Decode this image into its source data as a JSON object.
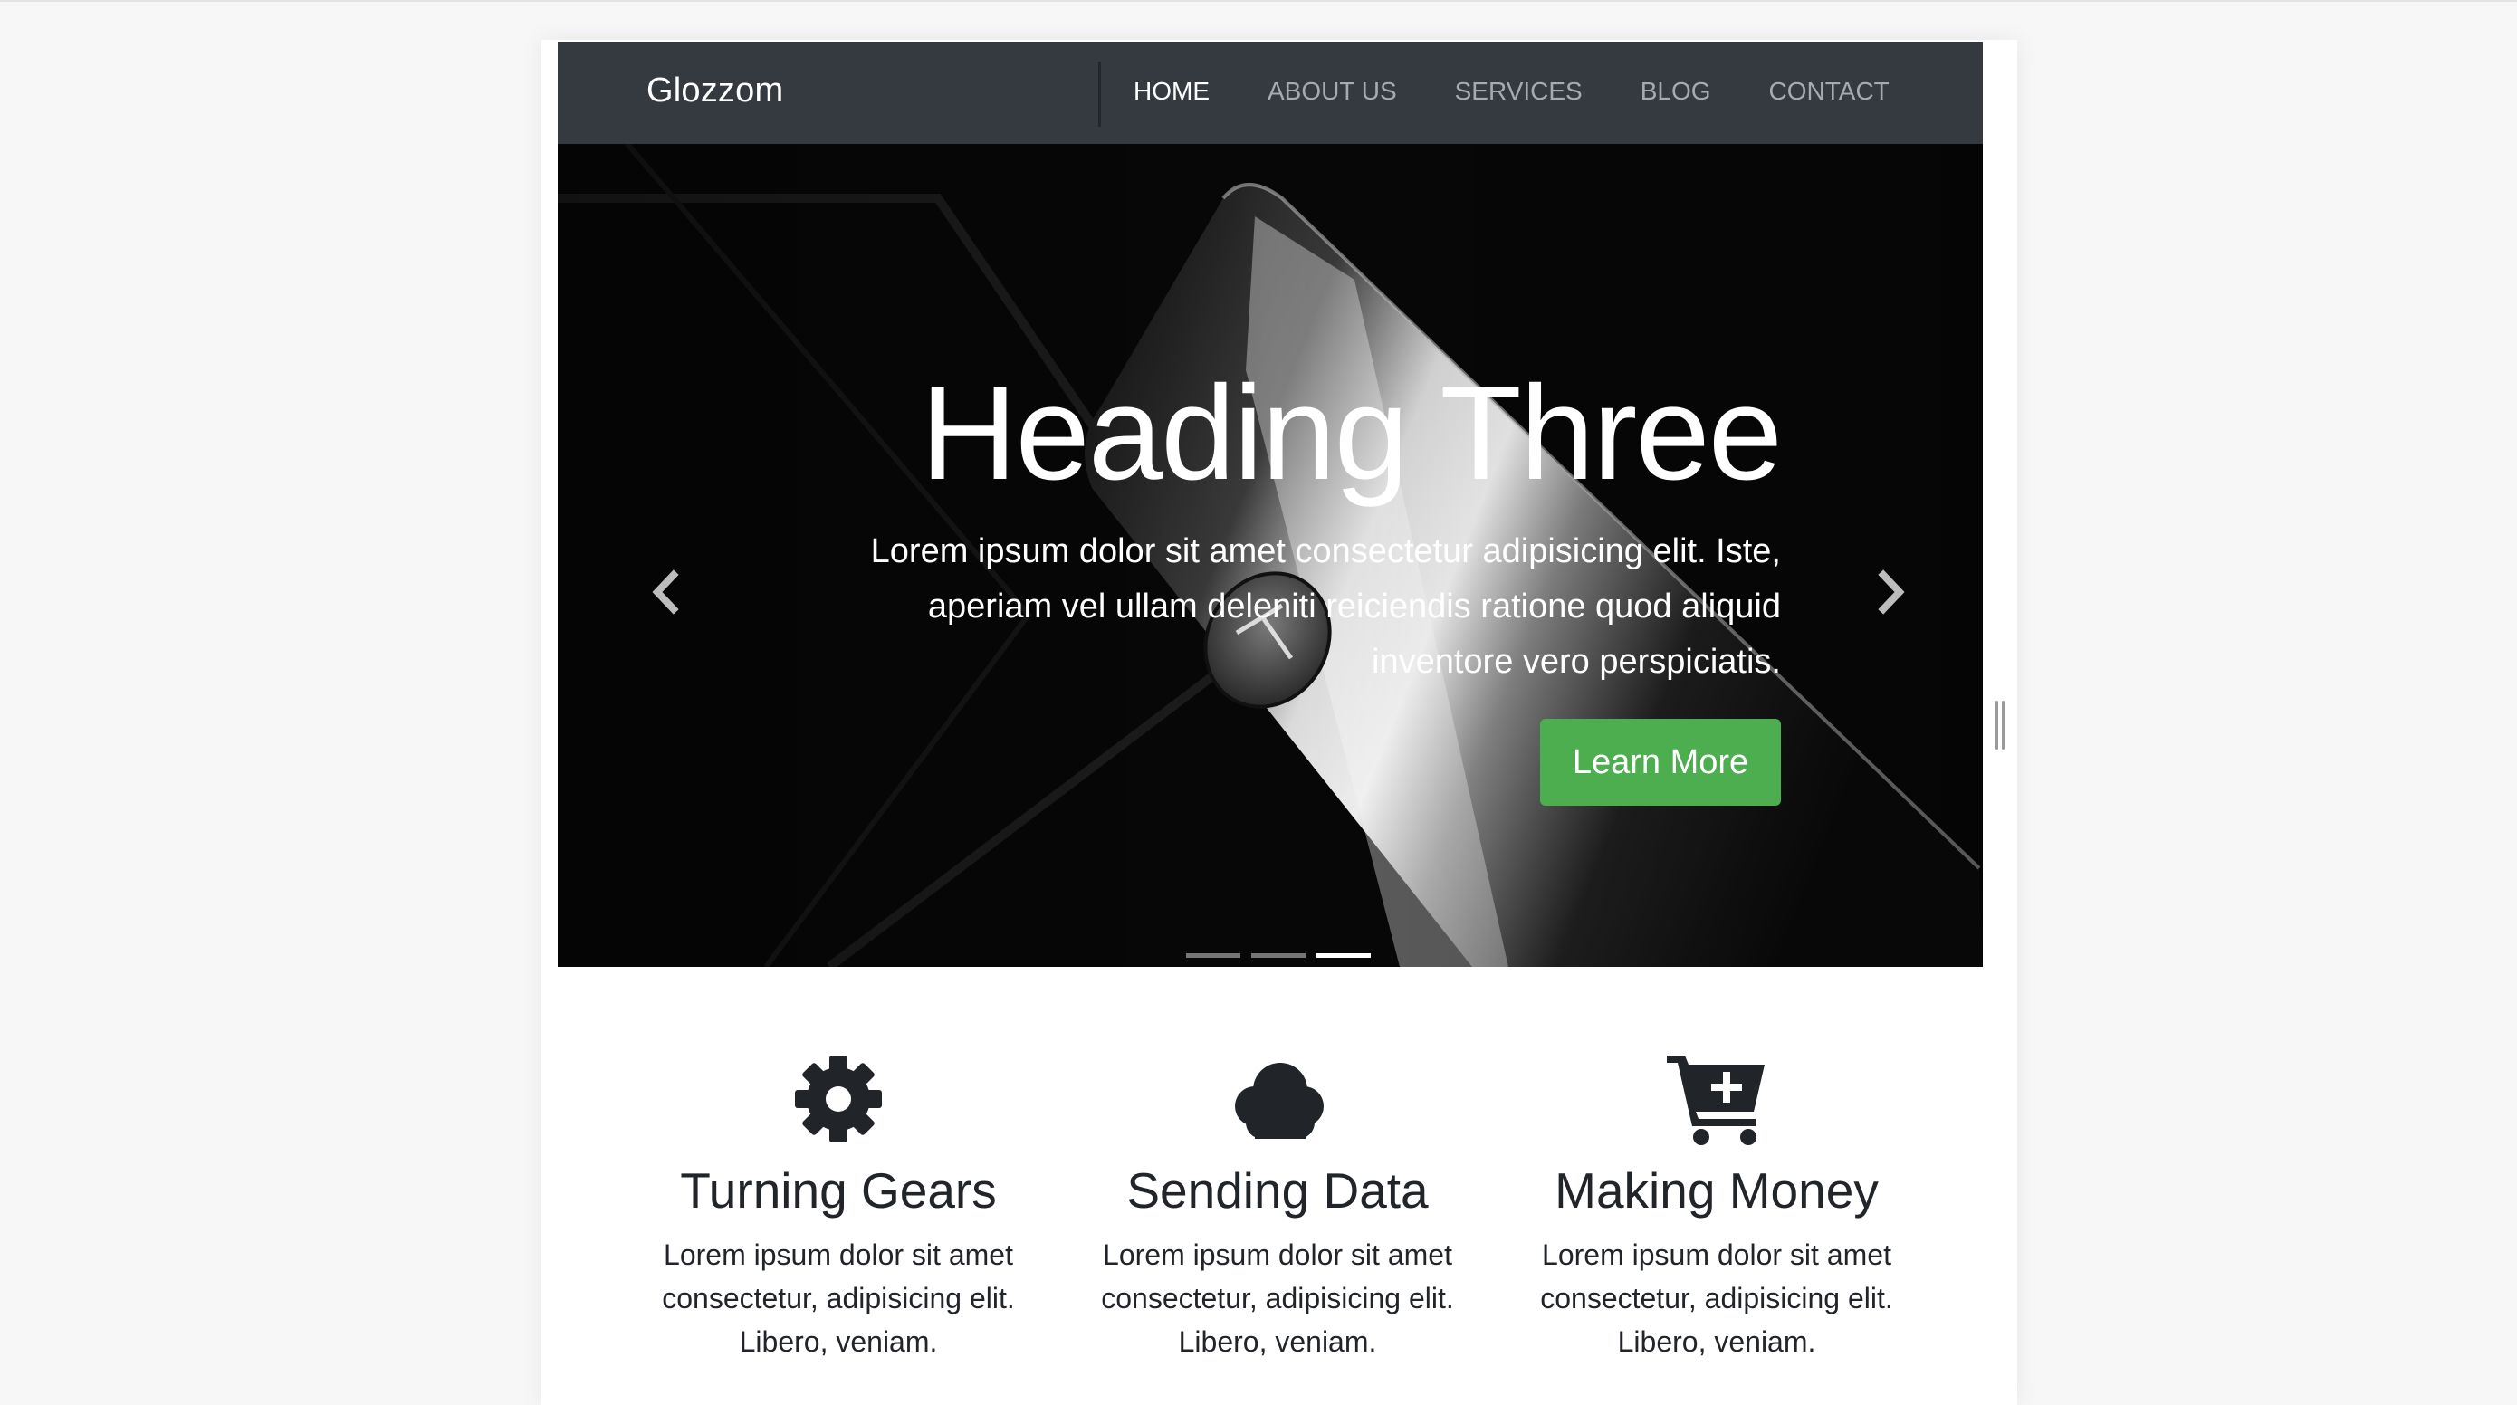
{
  "navbar": {
    "brand": "Glozzom",
    "links": [
      {
        "label": "HOME",
        "active": true
      },
      {
        "label": "ABOUT US",
        "active": false
      },
      {
        "label": "SERVICES",
        "active": false
      },
      {
        "label": "BLOG",
        "active": false
      },
      {
        "label": "CONTACT",
        "active": false
      }
    ]
  },
  "hero": {
    "heading": "Heading Three",
    "text": "Lorem ipsum dolor sit amet consectetur adipisicing elit. Iste, aperiam vel ullam deleniti reiciendis ratione quod aliquid inventore vero perspiciatis.",
    "button_label": "Learn More",
    "button_color": "#4cae4f",
    "prev_icon": "chevron-left-icon",
    "next_icon": "chevron-right-icon",
    "slide_count": 3,
    "active_slide": 3
  },
  "features": [
    {
      "icon": "gear-icon",
      "title": "Turning Gears",
      "text": "Lorem ipsum dolor sit amet consectetur, adipisicing elit. Libero, veniam."
    },
    {
      "icon": "cloud-icon",
      "title": "Sending Data",
      "text": "Lorem ipsum dolor sit amet consectetur, adipisicing elit. Libero, veniam."
    },
    {
      "icon": "cart-plus-icon",
      "title": "Making Money",
      "text": "Lorem ipsum dolor sit amet consectetur, adipisicing elit. Libero, veniam."
    }
  ],
  "colors": {
    "navbar_bg": "#343a40",
    "nav_link": "#a7abaf",
    "nav_link_active": "#ffffff",
    "text_dark": "#212529"
  }
}
